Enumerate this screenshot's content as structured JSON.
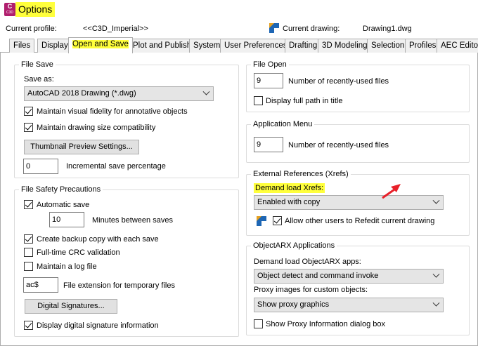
{
  "window": {
    "title": "Options",
    "app_icon_letter": "C",
    "app_icon_sub": "C3D"
  },
  "header": {
    "current_profile_label": "Current profile:",
    "current_profile_value": "<<C3D_Imperial>>",
    "current_drawing_label": "Current drawing:",
    "current_drawing_value": "Drawing1.dwg"
  },
  "tabs": [
    {
      "label": "Files"
    },
    {
      "label": "Display"
    },
    {
      "label": "Open and Save",
      "active": true
    },
    {
      "label": "Plot and Publish"
    },
    {
      "label": "System"
    },
    {
      "label": "User Preferences"
    },
    {
      "label": "Drafting"
    },
    {
      "label": "3D Modeling"
    },
    {
      "label": "Selection"
    },
    {
      "label": "Profiles"
    },
    {
      "label": "AEC Editor"
    }
  ],
  "file_save": {
    "legend": "File Save",
    "save_as_label": "Save as:",
    "save_as_value": "AutoCAD 2018 Drawing (*.dwg)",
    "maintain_visual_fidelity": {
      "label": "Maintain visual fidelity for annotative objects",
      "checked": true
    },
    "maintain_drawing_size": {
      "label": "Maintain drawing size compatibility",
      "checked": true
    },
    "thumbnail_button": "Thumbnail Preview Settings...",
    "incremental_value": "0",
    "incremental_label": "Incremental save percentage"
  },
  "file_safety": {
    "legend": "File Safety Precautions",
    "automatic_save": {
      "label": "Automatic save",
      "checked": true
    },
    "minutes_value": "10",
    "minutes_label": "Minutes between saves",
    "backup_copy": {
      "label": "Create backup copy with each save",
      "checked": true
    },
    "crc_validation": {
      "label": "Full-time CRC validation",
      "checked": false
    },
    "log_file": {
      "label": "Maintain a log file",
      "checked": false
    },
    "extension_value": "ac$",
    "extension_label": "File extension for temporary files",
    "digital_signatures_button": "Digital Signatures...",
    "display_signature": {
      "label": "Display digital signature information",
      "checked": true
    }
  },
  "file_open": {
    "legend": "File Open",
    "recent_value": "9",
    "recent_label": "Number of recently-used files",
    "full_path": {
      "label": "Display full path in title",
      "checked": false
    }
  },
  "application_menu": {
    "legend": "Application Menu",
    "recent_value": "9",
    "recent_label": "Number of recently-used files"
  },
  "xrefs": {
    "legend": "External References (Xrefs)",
    "demand_load_label": "Demand load Xrefs:",
    "demand_load_value": "Enabled with copy",
    "allow_refedit": {
      "label": "Allow other users to Refedit current drawing",
      "checked": true
    }
  },
  "objectarx": {
    "legend": "ObjectARX Applications",
    "demand_load_label": "Demand load ObjectARX apps:",
    "demand_load_value": "Object detect and command invoke",
    "proxy_label": "Proxy images for custom objects:",
    "proxy_value": "Show proxy graphics",
    "show_proxy_dialog": {
      "label": "Show Proxy Information dialog box",
      "checked": false
    }
  },
  "colors": {
    "highlight": "#ffff3c",
    "annotation_arrow": "#e8202a",
    "app_icon": "#b01e6e"
  }
}
